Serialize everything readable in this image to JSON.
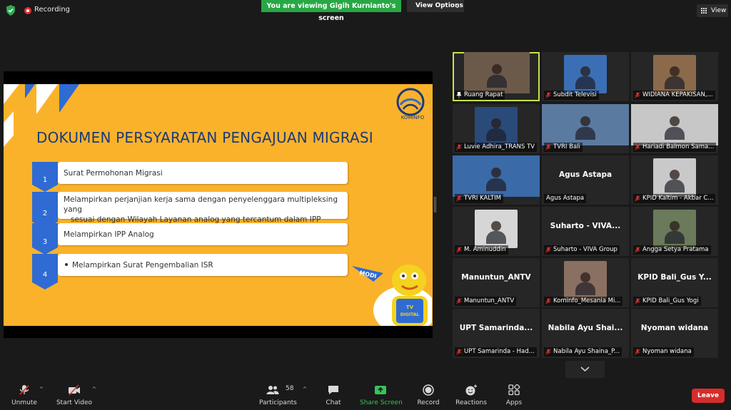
{
  "topbar": {
    "recording_label": "Recording",
    "viewing_banner": "You are viewing Gigih Kurnianto's screen",
    "view_options_label": "View Options",
    "view_label": "View"
  },
  "slide": {
    "title": "DOKUMEN PERSYARATAN PENGAJUAN MIGRASI",
    "logo_text": "KOMINFO",
    "items": [
      {
        "num": "1",
        "line1": "Surat Permohonan Migrasi",
        "line2": ""
      },
      {
        "num": "2",
        "line1": "Melampirkan perjanjian kerja sama dengan penyelenggara multipleksing yang",
        "line2": "sesuai dengan Wilayah Layanan analog yang tercantum dalam IPP"
      },
      {
        "num": "3",
        "line1": "Melampirkan IPP Analog",
        "line2": ""
      },
      {
        "num": "4",
        "line1": "Melampirkan Surat Pengembalian ISR",
        "line2": ""
      }
    ],
    "mascot_flag": "MODI",
    "mascot_shirt_top": "TV",
    "mascot_shirt_bottom": "DIGITAL"
  },
  "gallery": {
    "tiles": [
      {
        "label": "Ruang Rapat",
        "big": "",
        "type": "video",
        "pinned": true,
        "active": true
      },
      {
        "label": "Subdit Televisi",
        "big": "",
        "type": "video",
        "pinned": false,
        "active": false
      },
      {
        "label": "WIDIANA KEPAKISAN,...",
        "big": "",
        "type": "video",
        "muted": true
      },
      {
        "label": "Luvie Adhira_TRANS TV",
        "big": "",
        "type": "video",
        "muted": true
      },
      {
        "label": "TVRI Bali",
        "big": "",
        "type": "video",
        "muted": true
      },
      {
        "label": "Hariadi Balmon Sama...",
        "big": "",
        "type": "video",
        "muted": true
      },
      {
        "label": "TVRI KALTIM",
        "big": "",
        "type": "video",
        "muted": true
      },
      {
        "label": "Agus Astapa",
        "big": "Agus Astapa",
        "type": "name"
      },
      {
        "label": "KPID Kaltim - Akbar C...",
        "big": "",
        "type": "video",
        "muted": true
      },
      {
        "label": "M. Aminuddin",
        "big": "",
        "type": "video",
        "muted": true
      },
      {
        "label": "Suharto - VIVA Group",
        "big": "Suharto - VIVA...",
        "type": "name",
        "muted": true
      },
      {
        "label": "Angga Setya Pratama",
        "big": "",
        "type": "video",
        "muted": true
      },
      {
        "label": "Manuntun_ANTV",
        "big": "Manuntun_ANTV",
        "type": "name",
        "muted": true
      },
      {
        "label": "Kominfo_Mesania Mi...",
        "big": "",
        "type": "video",
        "muted": true
      },
      {
        "label": "KPID Bali_Gus Yogi",
        "big": "KPID Bali_Gus Y...",
        "type": "name",
        "muted": true
      },
      {
        "label": "UPT Samarinda - Had...",
        "big": "UPT Samarinda...",
        "type": "name",
        "muted": true
      },
      {
        "label": "Nabila Ayu Shaina_P...",
        "big": "Nabila Ayu Shai...",
        "type": "name",
        "muted": true
      },
      {
        "label": "Nyoman widana",
        "big": "Nyoman widana",
        "type": "name",
        "muted": true
      }
    ]
  },
  "toolbar": {
    "unmute": "Unmute",
    "start_video": "Start Video",
    "participants": "Participants",
    "participants_count": "58",
    "chat": "Chat",
    "share_screen": "Share Screen",
    "record": "Record",
    "reactions": "Reactions",
    "apps": "Apps",
    "leave": "Leave"
  },
  "colors": {
    "background": "#1a1a1a",
    "banner_green": "#27a844",
    "slide_yellow": "#fbb22b",
    "slide_blue": "#1b3a7a",
    "active_border": "#c7e34a",
    "leave_red": "#d62d2b",
    "muted_red": "#e0312f"
  }
}
